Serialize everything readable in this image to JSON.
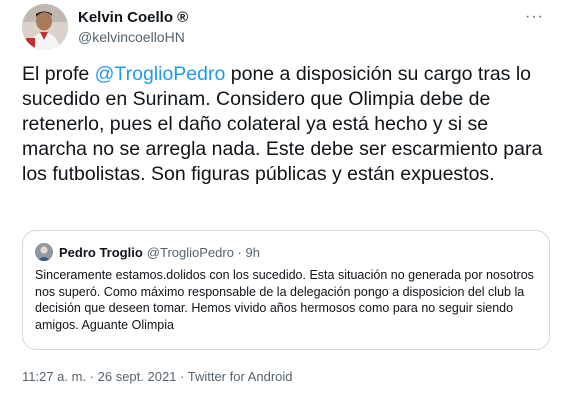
{
  "author": {
    "display_name": "Kelvin Coello ®",
    "handle": "@kelvincoelloHN"
  },
  "more_icon": "more-dots-icon",
  "tweet": {
    "text_before": "El profe ",
    "mention": "@TroglioPedro",
    "text_after": " pone a disposición su cargo tras lo sucedido en Surinam. Considero que Olimpia debe de retenerlo, pues el daño colateral ya está hecho y si se marcha no se arregla nada. Este debe ser escarmiento para los futbolistas. Son figuras públicas y están expuestos."
  },
  "quoted": {
    "name": "Pedro Troglio",
    "handle_time": "@TroglioPedro · 9h",
    "text": "Sinceramente estamos.dolidos con los sucedido. Esta situación no generada por nosotros nos superó. Como máximo responsable de la delegación pongo a disposicion del club la decisión que deseen tomar. Hemos vivido años hermosos como para no seguir siendo amigos. Aguante Olimpia"
  },
  "meta": "11:27 a. m. · 26 sept. 2021 · Twitter for Android",
  "colors": {
    "link": "#1d9bf0",
    "secondary_text": "#536471",
    "border": "#cfd9de"
  }
}
